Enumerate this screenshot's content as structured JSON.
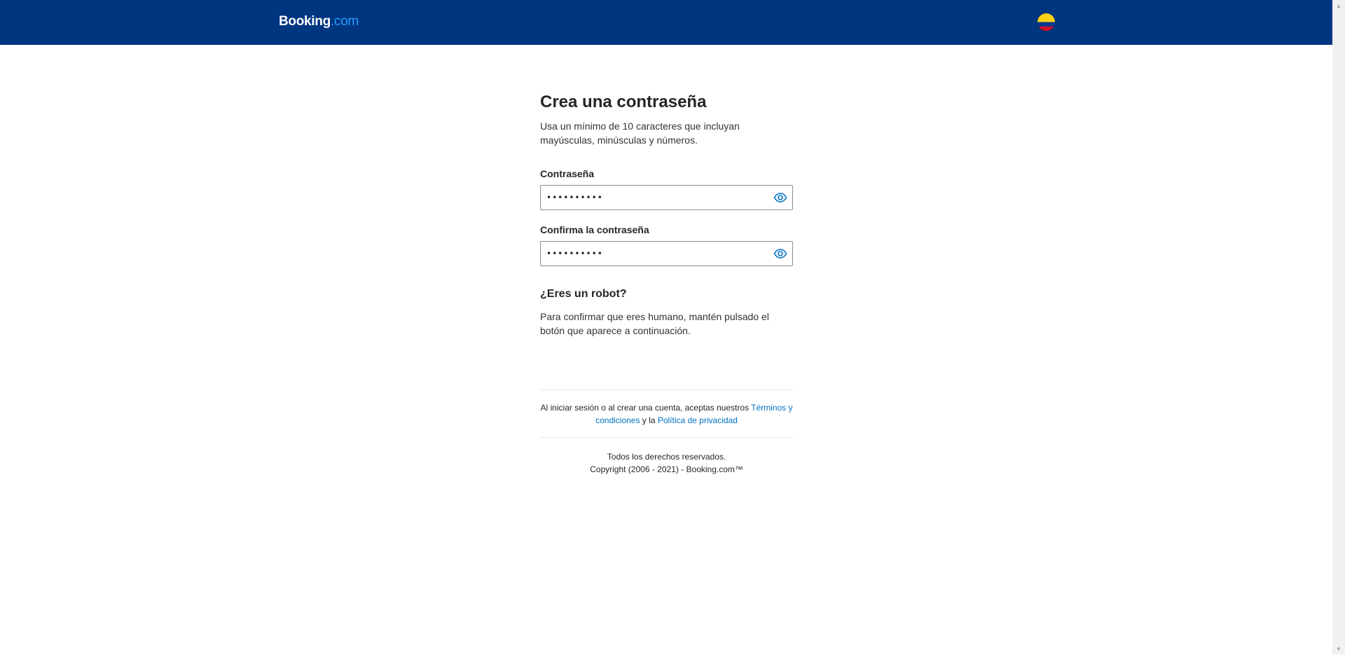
{
  "header": {
    "logo_brand": "Booking",
    "logo_tld": ".com",
    "flag_icon": "colombia-flag-icon",
    "colors": {
      "background": "#003580",
      "logo_accent": "#2a9cff",
      "flag": [
        "#fcd116",
        "#003893",
        "#ce1126"
      ]
    }
  },
  "form": {
    "title": "Crea una contraseña",
    "subtitle": "Usa un mínimo de 10 caracteres que incluyan mayúsculas, minúsculas y números.",
    "password": {
      "label": "Contraseña",
      "value": "••••••••••",
      "toggle_icon": "eye-icon"
    },
    "confirm_password": {
      "label": "Confirma la contraseña",
      "value": "••••••••••",
      "toggle_icon": "eye-icon"
    }
  },
  "robot": {
    "heading": "¿Eres un robot?",
    "text": "Para confirmar que eres humano, mantén pulsado el botón que aparece a continuación."
  },
  "terms": {
    "prefix": "Al iniciar sesión o al crear una cuenta, aceptas nuestros ",
    "terms_link": "Términos y condiciones",
    "middle": " y la ",
    "privacy_link": "Política de privacidad",
    "link_color": "#0071c2"
  },
  "footer": {
    "line1": "Todos los derechos reservados.",
    "line2": "Copyright (2006 - 2021) - Booking.com™"
  }
}
